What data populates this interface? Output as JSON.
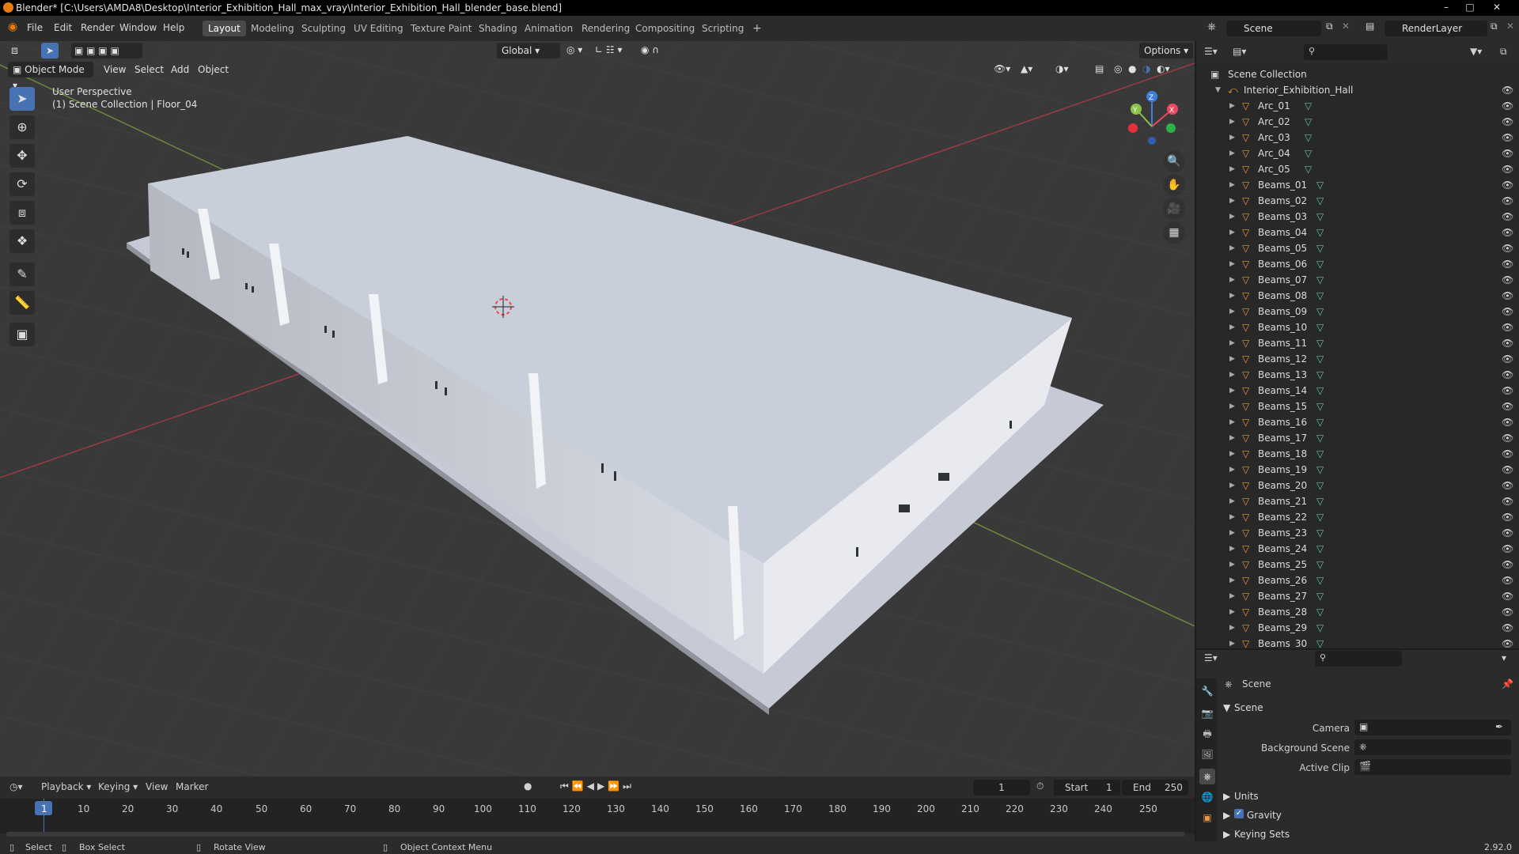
{
  "window": {
    "title": "Blender* [C:\\Users\\AMDA8\\Desktop\\Interior_Exhibition_Hall_max_vray\\Interior_Exhibition_Hall_blender_base.blend]"
  },
  "menu": [
    "File",
    "Edit",
    "Render",
    "Window",
    "Help"
  ],
  "workspaces": [
    "Layout",
    "Modeling",
    "Sculpting",
    "UV Editing",
    "Texture Paint",
    "Shading",
    "Animation",
    "Rendering",
    "Compositing",
    "Scripting"
  ],
  "active_workspace": "Layout",
  "scene_selector": {
    "scene": "Scene",
    "view_layer": "RenderLayer"
  },
  "viewport": {
    "mode": "Object Mode",
    "menus": [
      "View",
      "Select",
      "Add",
      "Object"
    ],
    "orientation": "Global",
    "options_label": "Options",
    "info_line1": "User Perspective",
    "info_line2": "(1) Scene Collection | Floor_04",
    "gizmo_labels": {
      "x": "X",
      "y": "Y",
      "z": "Z"
    }
  },
  "outliner": {
    "root": "Scene Collection",
    "collection": "Interior_Exhibition_Hall",
    "items": [
      "Arc_01",
      "Arc_02",
      "Arc_03",
      "Arc_04",
      "Arc_05",
      "Beams_01",
      "Beams_02",
      "Beams_03",
      "Beams_04",
      "Beams_05",
      "Beams_06",
      "Beams_07",
      "Beams_08",
      "Beams_09",
      "Beams_10",
      "Beams_11",
      "Beams_12",
      "Beams_13",
      "Beams_14",
      "Beams_15",
      "Beams_16",
      "Beams_17",
      "Beams_18",
      "Beams_19",
      "Beams_20",
      "Beams_21",
      "Beams_22",
      "Beams_23",
      "Beams_24",
      "Beams_25",
      "Beams_26",
      "Beams_27",
      "Beams_28",
      "Beams_29",
      "Beams_30"
    ]
  },
  "properties": {
    "breadcrumb": "Scene",
    "panel_title": "Scene",
    "camera_label": "Camera",
    "background_scene_label": "Background Scene",
    "active_clip_label": "Active Clip",
    "units_label": "Units",
    "gravity_label": "Gravity",
    "gravity_checked": true,
    "keying_sets_label": "Keying Sets"
  },
  "timeline": {
    "menus": [
      "Playback",
      "Keying",
      "View",
      "Marker"
    ],
    "current_frame": "1",
    "start_label": "Start",
    "start_value": "1",
    "end_label": "End",
    "end_value": "250",
    "ruler": [
      "1",
      "10",
      "20",
      "30",
      "40",
      "50",
      "60",
      "70",
      "80",
      "90",
      "100",
      "110",
      "120",
      "130",
      "140",
      "150",
      "160",
      "170",
      "180",
      "190",
      "200",
      "210",
      "220",
      "230",
      "240",
      "250"
    ]
  },
  "statusbar": {
    "select": "Select",
    "box_select": "Box Select",
    "rotate_view": "Rotate View",
    "context_menu": "Object Context Menu",
    "version": "2.92.0"
  },
  "colors": {
    "accent": "#4772b3",
    "object_icon": "#e89a3c",
    "mesh_icon": "#63c69e",
    "axis_x": "#e84a5f",
    "axis_y": "#8bc34a",
    "axis_z": "#3d7fe0"
  }
}
